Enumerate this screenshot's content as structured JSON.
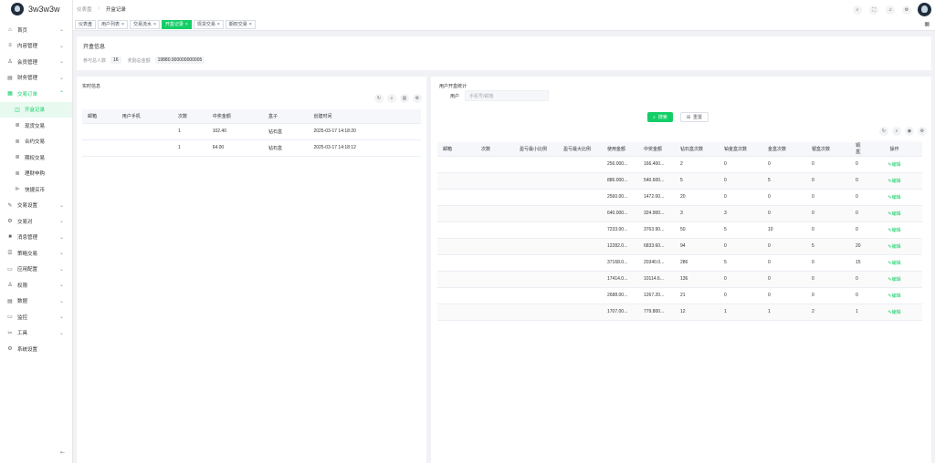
{
  "app": {
    "title": "3w3w3w"
  },
  "breadcrumb": [
    "仪表盘",
    "开盒记录"
  ],
  "tags": [
    {
      "label": "仪表盘",
      "closable": false,
      "active": false
    },
    {
      "label": "用户列表",
      "closable": true,
      "active": false
    },
    {
      "label": "交易流水",
      "closable": true,
      "active": false
    },
    {
      "label": "开盒记录",
      "closable": true,
      "active": true
    },
    {
      "label": "现货交易",
      "closable": true,
      "active": false
    },
    {
      "label": "期权交易",
      "closable": true,
      "active": false
    }
  ],
  "sidebar": {
    "items": [
      {
        "label": "首页",
        "icon": "home-icon",
        "glyph": "⌂",
        "chev": true
      },
      {
        "label": "内容管理",
        "icon": "content-icon",
        "glyph": "≡",
        "chev": true
      },
      {
        "label": "会员管理",
        "icon": "user-icon",
        "glyph": "♙",
        "chev": true
      },
      {
        "label": "财务管理",
        "icon": "finance-icon",
        "glyph": "▤",
        "chev": true
      },
      {
        "label": "交易订单",
        "icon": "order-icon",
        "glyph": "▦",
        "chev": true,
        "active": true,
        "expanded": true
      },
      {
        "label": "开盒记录",
        "icon": "box-icon",
        "glyph": "◫",
        "sub": true,
        "selected": true
      },
      {
        "label": "现货交易",
        "icon": "spot-icon",
        "glyph": "≣",
        "sub": true
      },
      {
        "label": "合约交易",
        "icon": "contract-icon",
        "glyph": "≣",
        "sub": true
      },
      {
        "label": "期权交易",
        "icon": "option-icon",
        "glyph": "≣",
        "sub": true
      },
      {
        "label": "理财申购",
        "icon": "wealth-icon",
        "glyph": "≣",
        "sub": true
      },
      {
        "label": "快捷买币",
        "icon": "quick-buy-icon",
        "glyph": "⊫",
        "sub": true
      },
      {
        "label": "交易设置",
        "icon": "trade-settings-icon",
        "glyph": "✎",
        "chev": true
      },
      {
        "label": "交易对",
        "icon": "pair-icon",
        "glyph": "⚙",
        "chev": true
      },
      {
        "label": "消息管理",
        "icon": "message-icon",
        "glyph": "■",
        "chev": true
      },
      {
        "label": "策略交易",
        "icon": "strategy-icon",
        "glyph": "☰",
        "chev": true
      },
      {
        "label": "应用配置",
        "icon": "app-config-icon",
        "glyph": "▭",
        "chev": true
      },
      {
        "label": "权限",
        "icon": "permission-icon",
        "glyph": "♙",
        "chev": true
      },
      {
        "label": "数据",
        "icon": "data-icon",
        "glyph": "▤",
        "chev": true
      },
      {
        "label": "监控",
        "icon": "monitor-icon",
        "glyph": "▭",
        "chev": true
      },
      {
        "label": "工具",
        "icon": "tools-icon",
        "glyph": "✂",
        "chev": true
      },
      {
        "label": "系统设置",
        "icon": "system-settings-icon",
        "glyph": "⚙",
        "chev": false
      }
    ]
  },
  "box_info": {
    "title": "开盒信息",
    "participants_label": "参与总人数",
    "participants_value": "16",
    "bonus_label": "奖励总金额",
    "bonus_value": "19880.900000000005"
  },
  "realtime": {
    "title": "实时信息",
    "columns": [
      "邮箱",
      "用户手机",
      "次数",
      "中奖金额",
      "盒子",
      "创建时间"
    ],
    "rows": [
      [
        "",
        "",
        "1",
        "102.40",
        "钻石盒",
        "2025-03-17 14:18:20"
      ],
      [
        "",
        "",
        "1",
        "64.00",
        "钻石盒",
        "2025-03-17 14:18:12"
      ]
    ]
  },
  "user_stats": {
    "title": "用户开盒统计",
    "user_label": "用户",
    "user_placeholder": "手机号/邮箱",
    "search_label": "搜索",
    "reset_label": "重置",
    "columns": [
      "邮箱",
      "次数",
      "盈亏最小比例",
      "盈亏最大比例",
      "使用金额",
      "中奖金额",
      "钻石盒次数",
      "铂金盒次数",
      "金盒次数",
      "银盒次数",
      "铜盒",
      "操作"
    ],
    "edit_label": "编辑",
    "rows": [
      [
        "",
        "",
        "",
        "",
        "256.000...",
        "166.400...",
        "2",
        "0",
        "0",
        "0",
        "0"
      ],
      [
        "",
        "",
        "",
        "",
        "886.000...",
        "540.600...",
        "5",
        "0",
        "5",
        "0",
        "0"
      ],
      [
        "",
        "",
        "",
        "",
        "2560.00...",
        "1472.00...",
        "20",
        "0",
        "0",
        "0",
        "0"
      ],
      [
        "",
        "",
        "",
        "",
        "640.000...",
        "324.900...",
        "3",
        "3",
        "0",
        "0",
        "0"
      ],
      [
        "",
        "",
        "",
        "",
        "7233.00...",
        "3763.90...",
        "50",
        "5",
        "10",
        "0",
        "0"
      ],
      [
        "",
        "",
        "",
        "",
        "12282.0...",
        "6833.60...",
        "94",
        "0",
        "0",
        "5",
        "20"
      ],
      [
        "",
        "",
        "",
        "",
        "37168.0...",
        "20340.0...",
        "286",
        "5",
        "0",
        "0",
        "15"
      ],
      [
        "",
        "",
        "",
        "",
        "17414.0...",
        "10114.6...",
        "136",
        "0",
        "0",
        "0",
        "0"
      ],
      [
        "",
        "",
        "",
        "",
        "2688.00...",
        "1267.20...",
        "21",
        "0",
        "0",
        "0",
        "0"
      ],
      [
        "",
        "",
        "",
        "",
        "1707.00...",
        "779.800...",
        "12",
        "1",
        "1",
        "2",
        "1"
      ]
    ]
  },
  "colors": {
    "accent": "#13ce66"
  }
}
